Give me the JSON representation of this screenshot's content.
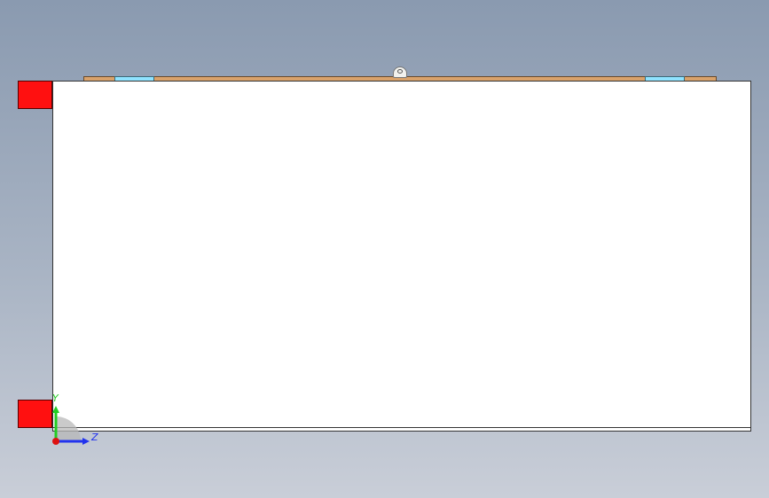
{
  "viewport": {
    "background_top": "#8a9ab0",
    "background_bottom": "#c9ced8"
  },
  "model": {
    "panel_color": "#ffffff",
    "rail_color": "#d9a26a",
    "slot_color": "#8fe3ff",
    "block_color": "#ff1010"
  },
  "triad": {
    "y_label": "Y",
    "z_label": "Z",
    "y_color": "#22cc22",
    "z_color": "#2233ee",
    "origin_color": "#dd1111"
  }
}
